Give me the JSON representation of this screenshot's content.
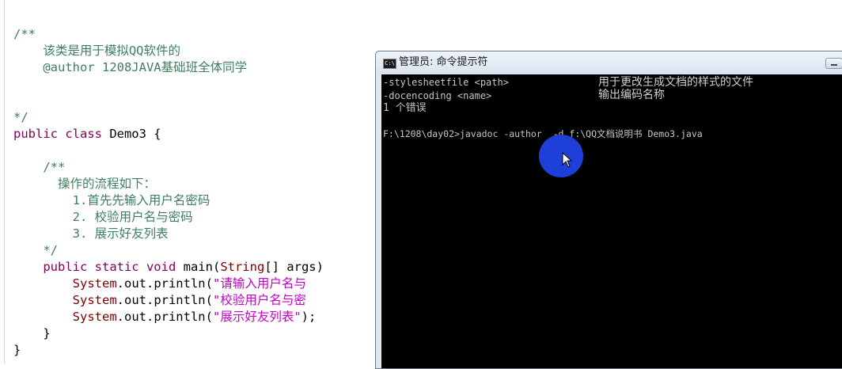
{
  "editor": {
    "lines": {
      "l1": "/**",
      "l2": "    该类是用于模拟QQ软件的",
      "l3": "    @author 1208JAVA基础班全体同学",
      "l4": "*/",
      "l5a": "public class",
      "l5b": " Demo3 {",
      "l6": "    /**",
      "l7": "      操作的流程如下：",
      "l8": "        1.首先先输入用户名密码",
      "l9": "        2. 校验用户名与密码",
      "l10": "        3. 展示好友列表",
      "l11": "    */",
      "l12a": "    public static void",
      "l12b": " main(",
      "l12c": "String",
      "l12d": "[] args)",
      "l13a": "        System",
      "l13b": ".out.println(",
      "l13c": "\"请输入用户名与",
      "l14a": "        System",
      "l14b": ".out.println(",
      "l14c": "\"校验用户名与密",
      "l15a": "        System",
      "l15b": ".out.println(",
      "l15c": "\"展示好友列表\"",
      "l15d": ");",
      "l16": "    }",
      "l17": "}"
    }
  },
  "console": {
    "title": "管理员: 命令提示符",
    "icon": "C:\\",
    "lines": {
      "o1a": "-stylesheetfile <path>",
      "o1b": "用于更改生成文档的样式的文件",
      "o2a": "-docencoding <name>",
      "o2b": "输出编码名称",
      "o3": "1 个错误",
      "cmd": "F:\\1208\\day02>javadoc -author  -d f:\\QQ文档说明书 Demo3.java"
    }
  },
  "colors": {
    "comment": "#3f7f5f",
    "keyword": "#7f0055",
    "string": "#c800c8",
    "class": "#7f0000",
    "cursor_highlight": "#1f3fd9"
  }
}
